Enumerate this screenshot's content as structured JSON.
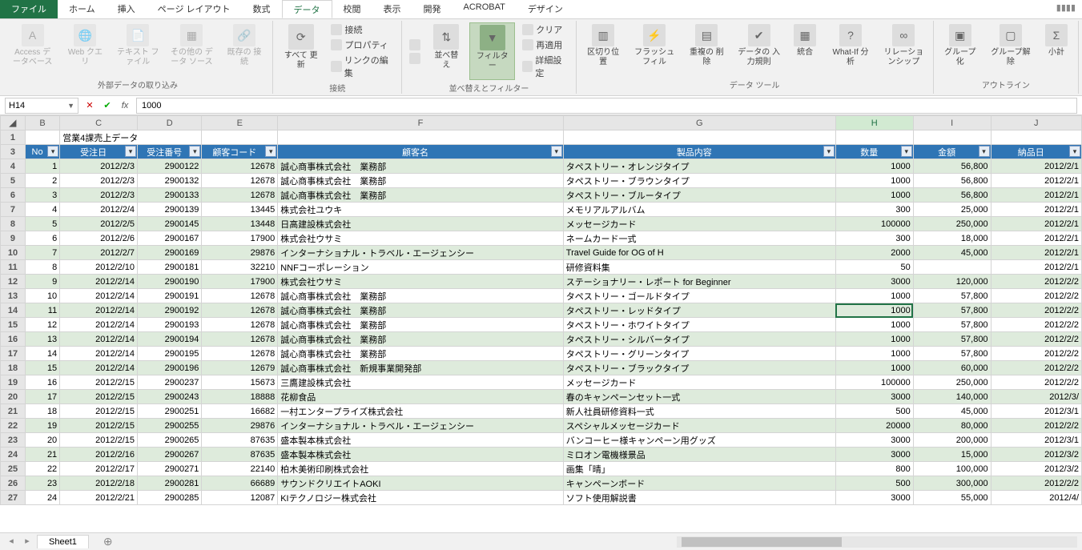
{
  "tabs": [
    "ファイル",
    "ホーム",
    "挿入",
    "ページ レイアウト",
    "数式",
    "データ",
    "校閲",
    "表示",
    "開発",
    "ACROBAT",
    "デザイン"
  ],
  "active_tab": "データ",
  "ribbon": {
    "import": {
      "access": "Access\nデータベース",
      "web": "Web\nクエリ",
      "text": "テキスト\nファイル",
      "other": "その他の\nデータ ソース",
      "existing": "既存の\n接続",
      "title": "外部データの取り込み"
    },
    "conn": {
      "refresh": "すべて\n更新",
      "conn": "接続",
      "prop": "プロパティ",
      "editlink": "リンクの編集",
      "title": "接続"
    },
    "sort": {
      "az": "A↓Z",
      "za": "Z↓A",
      "sort": "並べ替え",
      "filter": "フィルター",
      "clear": "クリア",
      "reapply": "再適用",
      "adv": "詳細設定",
      "title": "並べ替えとフィルター"
    },
    "tools": {
      "ttc": "区切り位置",
      "flash": "フラッシュ\nフィル",
      "dup": "重複の\n削除",
      "valid": "データの\n入力規則",
      "consol": "統合",
      "whatif": "What-If 分析",
      "rel": "リレーションシップ",
      "title": "データ ツール"
    },
    "outline": {
      "group": "グループ化",
      "ungroup": "グループ解除",
      "subtotal": "小計",
      "title": "アウトライン"
    }
  },
  "namebox": "H14",
  "formula": "1000",
  "sheet_title": "営業4課売上データ",
  "cols": [
    "A",
    "B",
    "C",
    "D",
    "E",
    "F",
    "G",
    "H",
    "I",
    "J"
  ],
  "headers": [
    "No",
    "受注日",
    "受注番号",
    "顧客コード",
    "顧客名",
    "製品内容",
    "数量",
    "金額",
    "納品日"
  ],
  "rows": [
    {
      "rn": 4,
      "no": 1,
      "d": "2012/2/3",
      "on": "2900122",
      "cc": "12678",
      "cn": "誠心商事株式会社　業務部",
      "pn": "タペストリー・オレンジタイプ",
      "qty": "1000",
      "amt": "56,800",
      "dd": "2012/2/1"
    },
    {
      "rn": 5,
      "no": 2,
      "d": "2012/2/3",
      "on": "2900132",
      "cc": "12678",
      "cn": "誠心商事株式会社　業務部",
      "pn": "タペストリー・ブラウンタイプ",
      "qty": "1000",
      "amt": "56,800",
      "dd": "2012/2/1"
    },
    {
      "rn": 6,
      "no": 3,
      "d": "2012/2/3",
      "on": "2900133",
      "cc": "12678",
      "cn": "誠心商事株式会社　業務部",
      "pn": "タペストリー・ブルータイプ",
      "qty": "1000",
      "amt": "56,800",
      "dd": "2012/2/1"
    },
    {
      "rn": 7,
      "no": 4,
      "d": "2012/2/4",
      "on": "2900139",
      "cc": "13445",
      "cn": "株式会社ユウキ",
      "pn": "メモリアルアルバム",
      "qty": "300",
      "amt": "25,000",
      "dd": "2012/2/1"
    },
    {
      "rn": 8,
      "no": 5,
      "d": "2012/2/5",
      "on": "2900145",
      "cc": "13448",
      "cn": "日高建設株式会社",
      "pn": "メッセージカード",
      "qty": "100000",
      "amt": "250,000",
      "dd": "2012/2/1"
    },
    {
      "rn": 9,
      "no": 6,
      "d": "2012/2/6",
      "on": "2900167",
      "cc": "17900",
      "cn": "株式会社ウサミ",
      "pn": "ネームカード一式",
      "qty": "300",
      "amt": "18,000",
      "dd": "2012/2/1"
    },
    {
      "rn": 10,
      "no": 7,
      "d": "2012/2/7",
      "on": "2900169",
      "cc": "29876",
      "cn": "インターナショナル・トラベル・エージェンシー",
      "pn": "Travel Guide for OG of H",
      "qty": "2000",
      "amt": "45,000",
      "dd": "2012/2/1"
    },
    {
      "rn": 11,
      "no": 8,
      "d": "2012/2/10",
      "on": "2900181",
      "cc": "32210",
      "cn": "NNFコーポレーション",
      "pn": "研修資料集",
      "qty": "50",
      "amt": "",
      "dd": "2012/2/1"
    },
    {
      "rn": 12,
      "no": 9,
      "d": "2012/2/14",
      "on": "2900190",
      "cc": "17900",
      "cn": "株式会社ウサミ",
      "pn": "ステーショナリー・レポート for Beginner",
      "qty": "3000",
      "amt": "120,000",
      "dd": "2012/2/2"
    },
    {
      "rn": 13,
      "no": 10,
      "d": "2012/2/14",
      "on": "2900191",
      "cc": "12678",
      "cn": "誠心商事株式会社　業務部",
      "pn": "タペストリー・ゴールドタイプ",
      "qty": "1000",
      "amt": "57,800",
      "dd": "2012/2/2"
    },
    {
      "rn": 14,
      "no": 11,
      "d": "2012/2/14",
      "on": "2900192",
      "cc": "12678",
      "cn": "誠心商事株式会社　業務部",
      "pn": "タペストリー・レッドタイプ",
      "qty": "1000",
      "amt": "57,800",
      "dd": "2012/2/2",
      "sel": true
    },
    {
      "rn": 15,
      "no": 12,
      "d": "2012/2/14",
      "on": "2900193",
      "cc": "12678",
      "cn": "誠心商事株式会社　業務部",
      "pn": "タペストリー・ホワイトタイプ",
      "qty": "1000",
      "amt": "57,800",
      "dd": "2012/2/2"
    },
    {
      "rn": 16,
      "no": 13,
      "d": "2012/2/14",
      "on": "2900194",
      "cc": "12678",
      "cn": "誠心商事株式会社　業務部",
      "pn": "タペストリー・シルバータイプ",
      "qty": "1000",
      "amt": "57,800",
      "dd": "2012/2/2"
    },
    {
      "rn": 17,
      "no": 14,
      "d": "2012/2/14",
      "on": "2900195",
      "cc": "12678",
      "cn": "誠心商事株式会社　業務部",
      "pn": "タペストリー・グリーンタイプ",
      "qty": "1000",
      "amt": "57,800",
      "dd": "2012/2/2"
    },
    {
      "rn": 18,
      "no": 15,
      "d": "2012/2/14",
      "on": "2900196",
      "cc": "12679",
      "cn": "誠心商事株式会社　新規事業開発部",
      "pn": "タペストリー・ブラックタイプ",
      "qty": "1000",
      "amt": "60,000",
      "dd": "2012/2/2"
    },
    {
      "rn": 19,
      "no": 16,
      "d": "2012/2/15",
      "on": "2900237",
      "cc": "15673",
      "cn": "三鷹建設株式会社",
      "pn": "メッセージカード",
      "qty": "100000",
      "amt": "250,000",
      "dd": "2012/2/2"
    },
    {
      "rn": 20,
      "no": 17,
      "d": "2012/2/15",
      "on": "2900243",
      "cc": "18888",
      "cn": "花柳食品",
      "pn": "春のキャンペーンセット一式",
      "qty": "3000",
      "amt": "140,000",
      "dd": "2012/3/"
    },
    {
      "rn": 21,
      "no": 18,
      "d": "2012/2/15",
      "on": "2900251",
      "cc": "16682",
      "cn": "一村エンタープライズ株式会社",
      "pn": "新人社員研修資料一式",
      "qty": "500",
      "amt": "45,000",
      "dd": "2012/3/1"
    },
    {
      "rn": 22,
      "no": 19,
      "d": "2012/2/15",
      "on": "2900255",
      "cc": "29876",
      "cn": "インターナショナル・トラベル・エージェンシー",
      "pn": "スペシャルメッセージカード",
      "qty": "20000",
      "amt": "80,000",
      "dd": "2012/2/2"
    },
    {
      "rn": 23,
      "no": 20,
      "d": "2012/2/15",
      "on": "2900265",
      "cc": "87635",
      "cn": "盛本製本株式会社",
      "pn": "バンコーヒー様キャンペーン用グッズ",
      "qty": "3000",
      "amt": "200,000",
      "dd": "2012/3/1"
    },
    {
      "rn": 24,
      "no": 21,
      "d": "2012/2/16",
      "on": "2900267",
      "cc": "87635",
      "cn": "盛本製本株式会社",
      "pn": "ミロオン電機様景品",
      "qty": "3000",
      "amt": "15,000",
      "dd": "2012/3/2"
    },
    {
      "rn": 25,
      "no": 22,
      "d": "2012/2/17",
      "on": "2900271",
      "cc": "22140",
      "cn": "柏木美術印刷株式会社",
      "pn": "画集「晴」",
      "qty": "800",
      "amt": "100,000",
      "dd": "2012/3/2"
    },
    {
      "rn": 26,
      "no": 23,
      "d": "2012/2/18",
      "on": "2900281",
      "cc": "66689",
      "cn": "サウンドクリエイトAOKI",
      "pn": "キャンペーンボード",
      "qty": "500",
      "amt": "300,000",
      "dd": "2012/2/2"
    },
    {
      "rn": 27,
      "no": 24,
      "d": "2012/2/21",
      "on": "2900285",
      "cc": "12087",
      "cn": "KIテクノロジー株式会社",
      "pn": "ソフト使用解説書",
      "qty": "3000",
      "amt": "55,000",
      "dd": "2012/4/"
    }
  ],
  "sheet_tab": "Sheet1"
}
